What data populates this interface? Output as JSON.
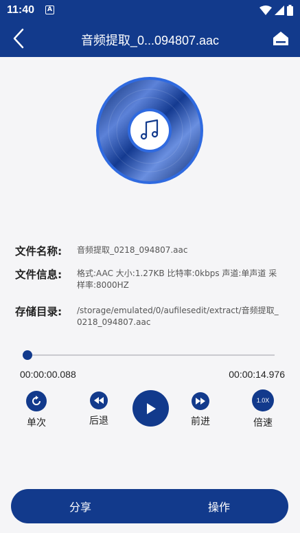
{
  "status": {
    "time": "11:40",
    "a_icon": "A"
  },
  "appbar": {
    "title": "音频提取_0...094807.aac"
  },
  "file_info": {
    "name_label": "文件名称:",
    "name_value": "音频提取_0218_094807.aac",
    "info_label": "文件信息:",
    "info_value": "格式:AAC  大小:1.27KB  比特率:0kbps  声道:单声道  采样率:8000HZ",
    "dir_label": "存储目录:",
    "dir_value": "/storage/emulated/0/aufilesedit/extract/音频提取_0218_094807.aac"
  },
  "player": {
    "current_time": "00:00:00.088",
    "total_time": "00:00:14.976",
    "progress_fraction": 0.006,
    "controls": {
      "single_label": "单次",
      "rewind_label": "后退",
      "forward_label": "前进",
      "speed_label": "倍速",
      "speed_value": "1.0X"
    }
  },
  "bottom": {
    "share_label": "分享",
    "action_label": "操作"
  },
  "colors": {
    "primary": "#123a8c",
    "background": "#f5f5f7",
    "disc_ring": "#2f6ae0"
  }
}
